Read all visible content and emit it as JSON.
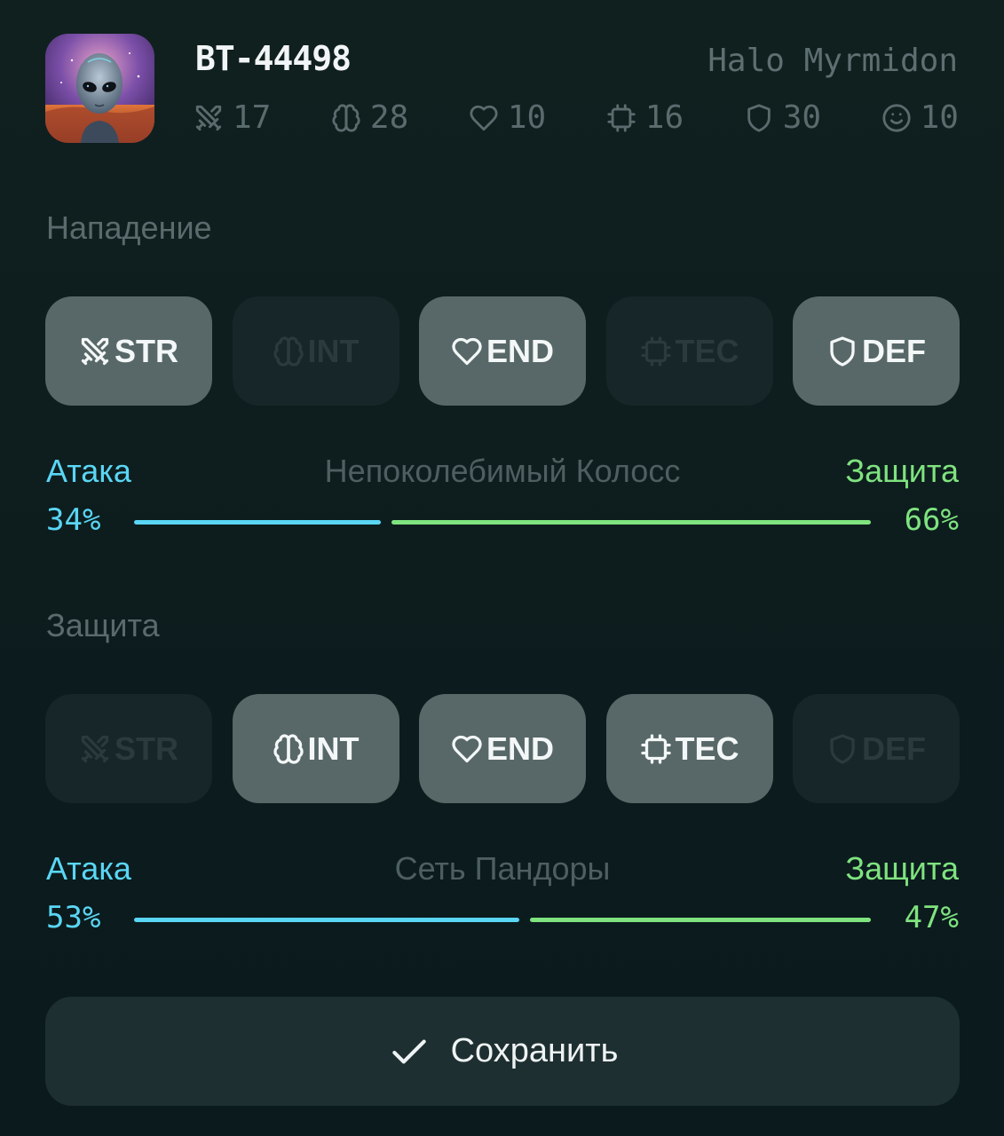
{
  "header": {
    "unit_id": "BT-44498",
    "unit_class": "Halo Myrmidon",
    "avatar_icon": "alien-portrait",
    "stats": [
      {
        "icon": "swords-icon",
        "value": "17"
      },
      {
        "icon": "brain-icon",
        "value": "28"
      },
      {
        "icon": "heart-icon",
        "value": "10"
      },
      {
        "icon": "chip-icon",
        "value": "16"
      },
      {
        "icon": "shield-icon",
        "value": "30"
      },
      {
        "icon": "smile-icon",
        "value": "10"
      }
    ]
  },
  "attack_section": {
    "title": "Нападение",
    "chips": [
      {
        "icon": "swords-icon",
        "label": "STR",
        "active": true
      },
      {
        "icon": "brain-icon",
        "label": "INT",
        "active": false
      },
      {
        "icon": "heart-icon",
        "label": "END",
        "active": true
      },
      {
        "icon": "chip-icon",
        "label": "TEC",
        "active": false
      },
      {
        "icon": "shield-icon",
        "label": "DEF",
        "active": true
      }
    ],
    "attack_label": "Атака",
    "profile_name": "Непоколебимый Колосс",
    "defense_label": "Защита",
    "attack_pct": "34%",
    "defense_pct": "66%",
    "attack_fraction": 0.34
  },
  "defense_section": {
    "title": "Защита",
    "chips": [
      {
        "icon": "swords-icon",
        "label": "STR",
        "active": false
      },
      {
        "icon": "brain-icon",
        "label": "INT",
        "active": true
      },
      {
        "icon": "heart-icon",
        "label": "END",
        "active": true
      },
      {
        "icon": "chip-icon",
        "label": "TEC",
        "active": true
      },
      {
        "icon": "shield-icon",
        "label": "DEF",
        "active": false
      }
    ],
    "attack_label": "Атака",
    "profile_name": "Сеть Пандоры",
    "defense_label": "Защита",
    "attack_pct": "53%",
    "defense_pct": "47%",
    "attack_fraction": 0.53
  },
  "save_button": {
    "label": "Сохранить",
    "icon": "check-icon"
  },
  "colors": {
    "attack": "#5ad6f5",
    "defense": "#7fe37f",
    "chip_active_bg": "#586868",
    "chip_inactive_bg": "#172628"
  }
}
